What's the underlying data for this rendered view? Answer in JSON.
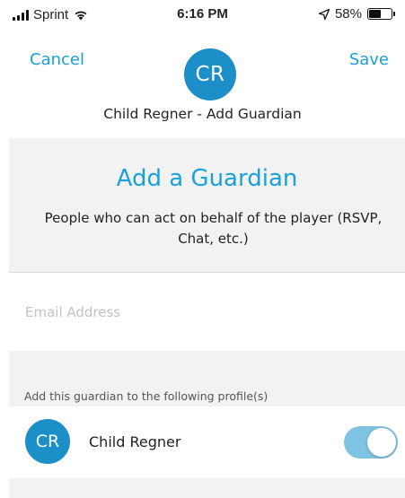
{
  "status_bar": {
    "carrier": "Sprint",
    "time": "6:16 PM",
    "battery_text": "58%",
    "battery_level": 0.58
  },
  "nav": {
    "cancel_label": "Cancel",
    "save_label": "Save",
    "avatar_initials": "CR",
    "title": "Child Regner - Add Guardian"
  },
  "header": {
    "heading": "Add a Guardian",
    "description": "People who can act on behalf of the player (RSVP, Chat, etc.)"
  },
  "email": {
    "value": "",
    "placeholder": "Email Address"
  },
  "profiles_section": {
    "label": "Add this guardian to the following profile(s)"
  },
  "profiles": [
    {
      "initials": "CR",
      "name": "Child Regner",
      "enabled": true
    }
  ],
  "colors": {
    "accent": "#1ba1d9",
    "avatar": "#1c8fc8",
    "toggle_on": "#7fc3e3",
    "panel_bg": "#f2f2f2"
  }
}
